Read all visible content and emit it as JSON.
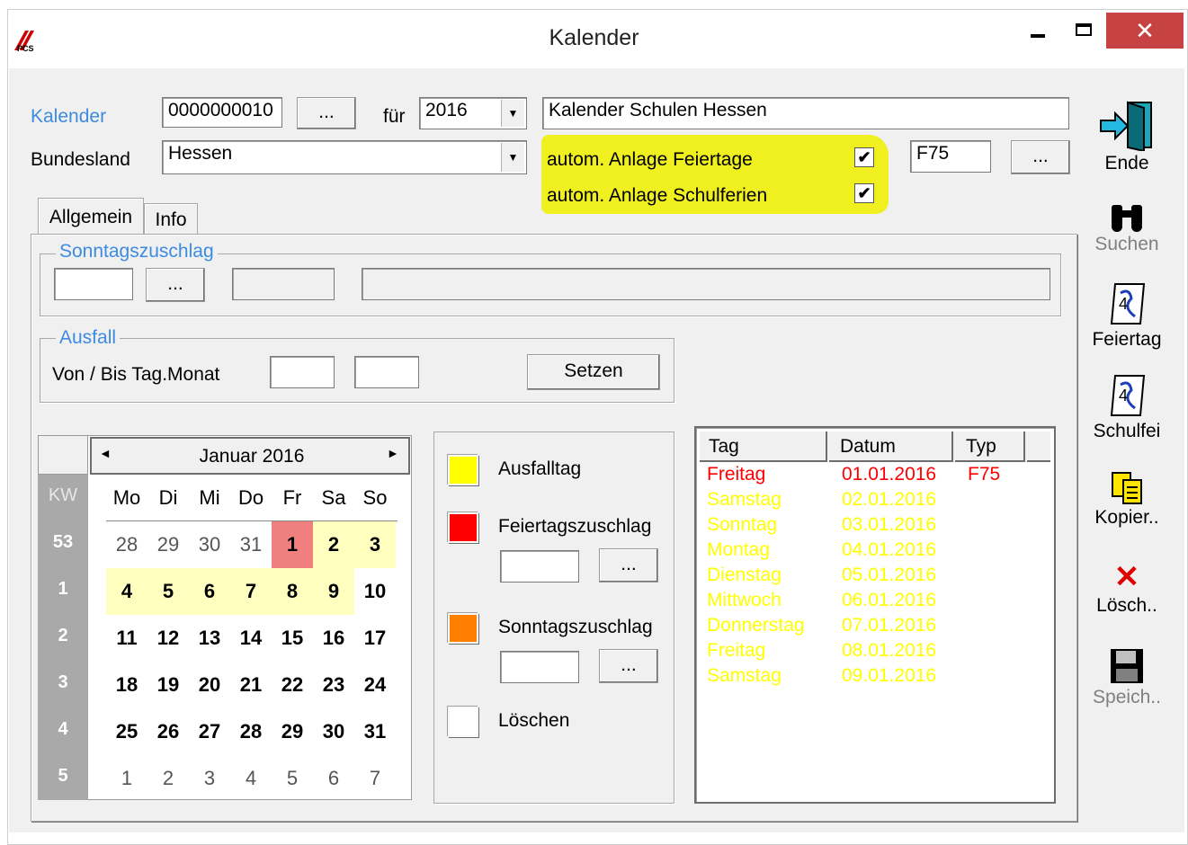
{
  "window": {
    "title": "Kalender"
  },
  "form": {
    "kalender_label": "Kalender",
    "kalender_value": "0000000010",
    "browse": "...",
    "fuer_label": "für",
    "year": "2016",
    "description": "Kalender Schulen  Hessen",
    "bundesland_label": "Bundesland",
    "bundesland_value": "Hessen",
    "feiertage_label": "autom. Anlage Feiertage",
    "schulferien_label": "autom. Anlage Schulferien",
    "feiertage_code": "F75",
    "check_mark": "✔"
  },
  "tabs": [
    "Allgemein",
    "Info"
  ],
  "sonntag_group": {
    "title": "Sonntagszuschlag",
    "browse": "..."
  },
  "ausfall_group": {
    "title": "Ausfall",
    "label": "Von / Bis Tag.Monat",
    "button": "Setzen"
  },
  "calendar": {
    "month_label": "Janu ar 2016",
    "kw_header": "KW",
    "weekdays": [
      "Mo",
      "Di",
      "Mi",
      "Do",
      "Fr",
      "Sa",
      "So"
    ],
    "weeks": [
      {
        "kw": "53",
        "days": [
          "28",
          "29",
          "30",
          "31",
          "1",
          "2",
          "3"
        ]
      },
      {
        "kw": "1",
        "days": [
          "4",
          "5",
          "6",
          "7",
          "8",
          "9",
          "10"
        ]
      },
      {
        "kw": "2",
        "days": [
          "11",
          "12",
          "13",
          "14",
          "15",
          "16",
          "17"
        ]
      },
      {
        "kw": "3",
        "days": [
          "18",
          "19",
          "20",
          "21",
          "22",
          "23",
          "24"
        ]
      },
      {
        "kw": "4",
        "days": [
          "25",
          "26",
          "27",
          "28",
          "29",
          "30",
          "31"
        ]
      },
      {
        "kw": "5",
        "days": [
          "1",
          "2",
          "3",
          "4",
          "5",
          "6",
          "7"
        ]
      }
    ],
    "arrow_left": "◄",
    "arrow_right": "►"
  },
  "legend": {
    "ausfalltag": "Ausfalltag",
    "feiertagszuschlag": "Feiertagszuschlag",
    "sonntagszuschlag": "Sonntagszuschlag",
    "loeschen": "Löschen",
    "browse": "...",
    "colors": {
      "ausfall": "#ffff00",
      "feiertag": "#ff0000",
      "sonntag": "#ff8000",
      "loeschen": "#ffffff"
    }
  },
  "list": {
    "headers": [
      "Tag",
      "Datum",
      "Typ"
    ],
    "rows": [
      {
        "tag": "Freitag",
        "datum": "01.01.2016",
        "typ": "F75",
        "color": "#ff0000"
      },
      {
        "tag": "Samstag",
        "datum": "02.01.2016",
        "typ": "",
        "color": "#ffff00"
      },
      {
        "tag": "Sonntag",
        "datum": "03.01.2016",
        "typ": "",
        "color": "#ffff00"
      },
      {
        "tag": "Montag",
        "datum": "04.01.2016",
        "typ": "",
        "color": "#ffff00"
      },
      {
        "tag": "Dienstag",
        "datum": "05.01.2016",
        "typ": "",
        "color": "#ffff00"
      },
      {
        "tag": "Mittwoch",
        "datum": "06.01.2016",
        "typ": "",
        "color": "#ffff00"
      },
      {
        "tag": "Donnerstag",
        "datum": "07.01.2016",
        "typ": "",
        "color": "#ffff00"
      },
      {
        "tag": "Freitag",
        "datum": "08.01.2016",
        "typ": "",
        "color": "#ffff00"
      },
      {
        "tag": "Samstag",
        "datum": "09.01.2016",
        "typ": "",
        "color": "#ffff00"
      }
    ]
  },
  "sidebar": {
    "ende": "Ende",
    "suchen": "Suchen",
    "feiertag": "Feiertag",
    "schulferien": "Schulfei",
    "kopieren": "Kopier..",
    "loeschen": "Lösch..",
    "speichern": "Speich.."
  },
  "colors": {
    "accent": "#3c8be0",
    "highlight": "#f0f020",
    "close": "#c74343"
  }
}
